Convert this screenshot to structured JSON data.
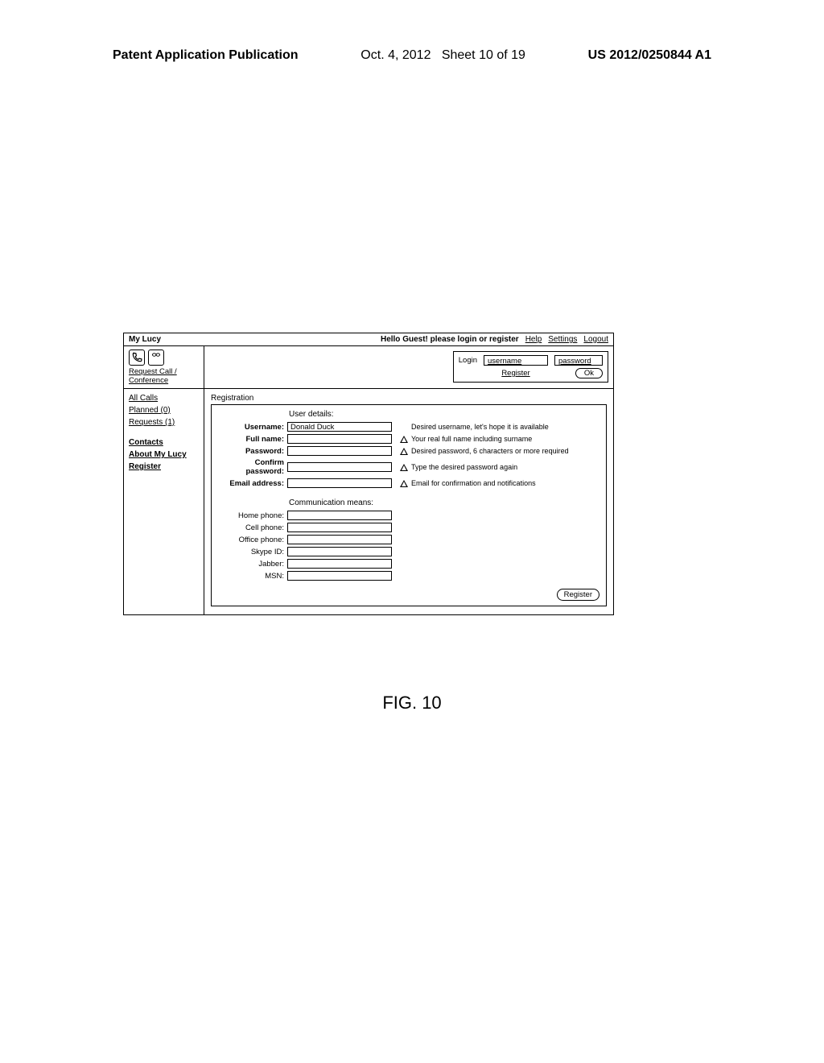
{
  "page_header": {
    "publication": "Patent Application Publication",
    "date": "Oct. 4, 2012",
    "sheet": "Sheet 10 of 19",
    "docnum": "US 2012/0250844 A1"
  },
  "titlebar": {
    "app_name": "My Lucy",
    "greeting": "Hello Guest! please login or register",
    "help": "Help",
    "settings": "Settings",
    "logout": "Logout"
  },
  "request_link": "Request Call / Conference",
  "login_box": {
    "login_label": "Login",
    "username_placeholder": "username",
    "password_placeholder": "password",
    "register_link": "Register",
    "ok": "Ok"
  },
  "sidebar": {
    "all_calls": "All Calls",
    "planned": "Planned",
    "planned_count": "(0)",
    "requests": "Requests",
    "requests_count": "(1)",
    "contacts": "Contacts",
    "about": "About My Lucy",
    "register": "Register"
  },
  "main": {
    "panel_title": "Registration",
    "section_user": "User details:",
    "section_comm": "Communication means:",
    "fields": {
      "username_label": "Username:",
      "username_value": "Donald Duck",
      "username_hint": "Desired username, let's hope it is available",
      "fullname_label": "Full name:",
      "fullname_hint": "Your real full name including surname",
      "password_label": "Password:",
      "password_hint": "Desired password, 6 characters or more required",
      "confirm_label": "Confirm password:",
      "confirm_hint": "Type the desired password again",
      "email_label": "Email address:",
      "email_hint": "Email for confirmation and notifications",
      "home_label": "Home phone:",
      "cell_label": "Cell phone:",
      "office_label": "Office phone:",
      "skype_label": "Skype ID:",
      "jabber_label": "Jabber:",
      "msn_label": "MSN:"
    },
    "register_button": "Register"
  },
  "figure_caption": "FIG. 10"
}
